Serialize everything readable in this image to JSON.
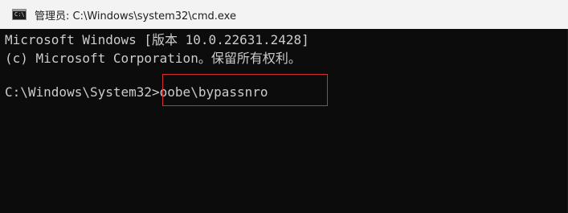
{
  "window": {
    "icon": "cmd-app-icon",
    "icon_label": "C:\\",
    "title": "管理员: C:\\Windows\\system32\\cmd.exe"
  },
  "terminal": {
    "lines": [
      "Microsoft Windows [版本 10.0.22631.2428]",
      "(c) Microsoft Corporation。保留所有权利。"
    ],
    "prompt": "C:\\Windows\\System32>",
    "command": "oobe\\bypassnro"
  },
  "colors": {
    "terminal_bg": "#0c0c0c",
    "terminal_fg": "#cccccc",
    "highlight_border": "#d32f2f",
    "titlebar_bg": "#f3f3f3"
  }
}
